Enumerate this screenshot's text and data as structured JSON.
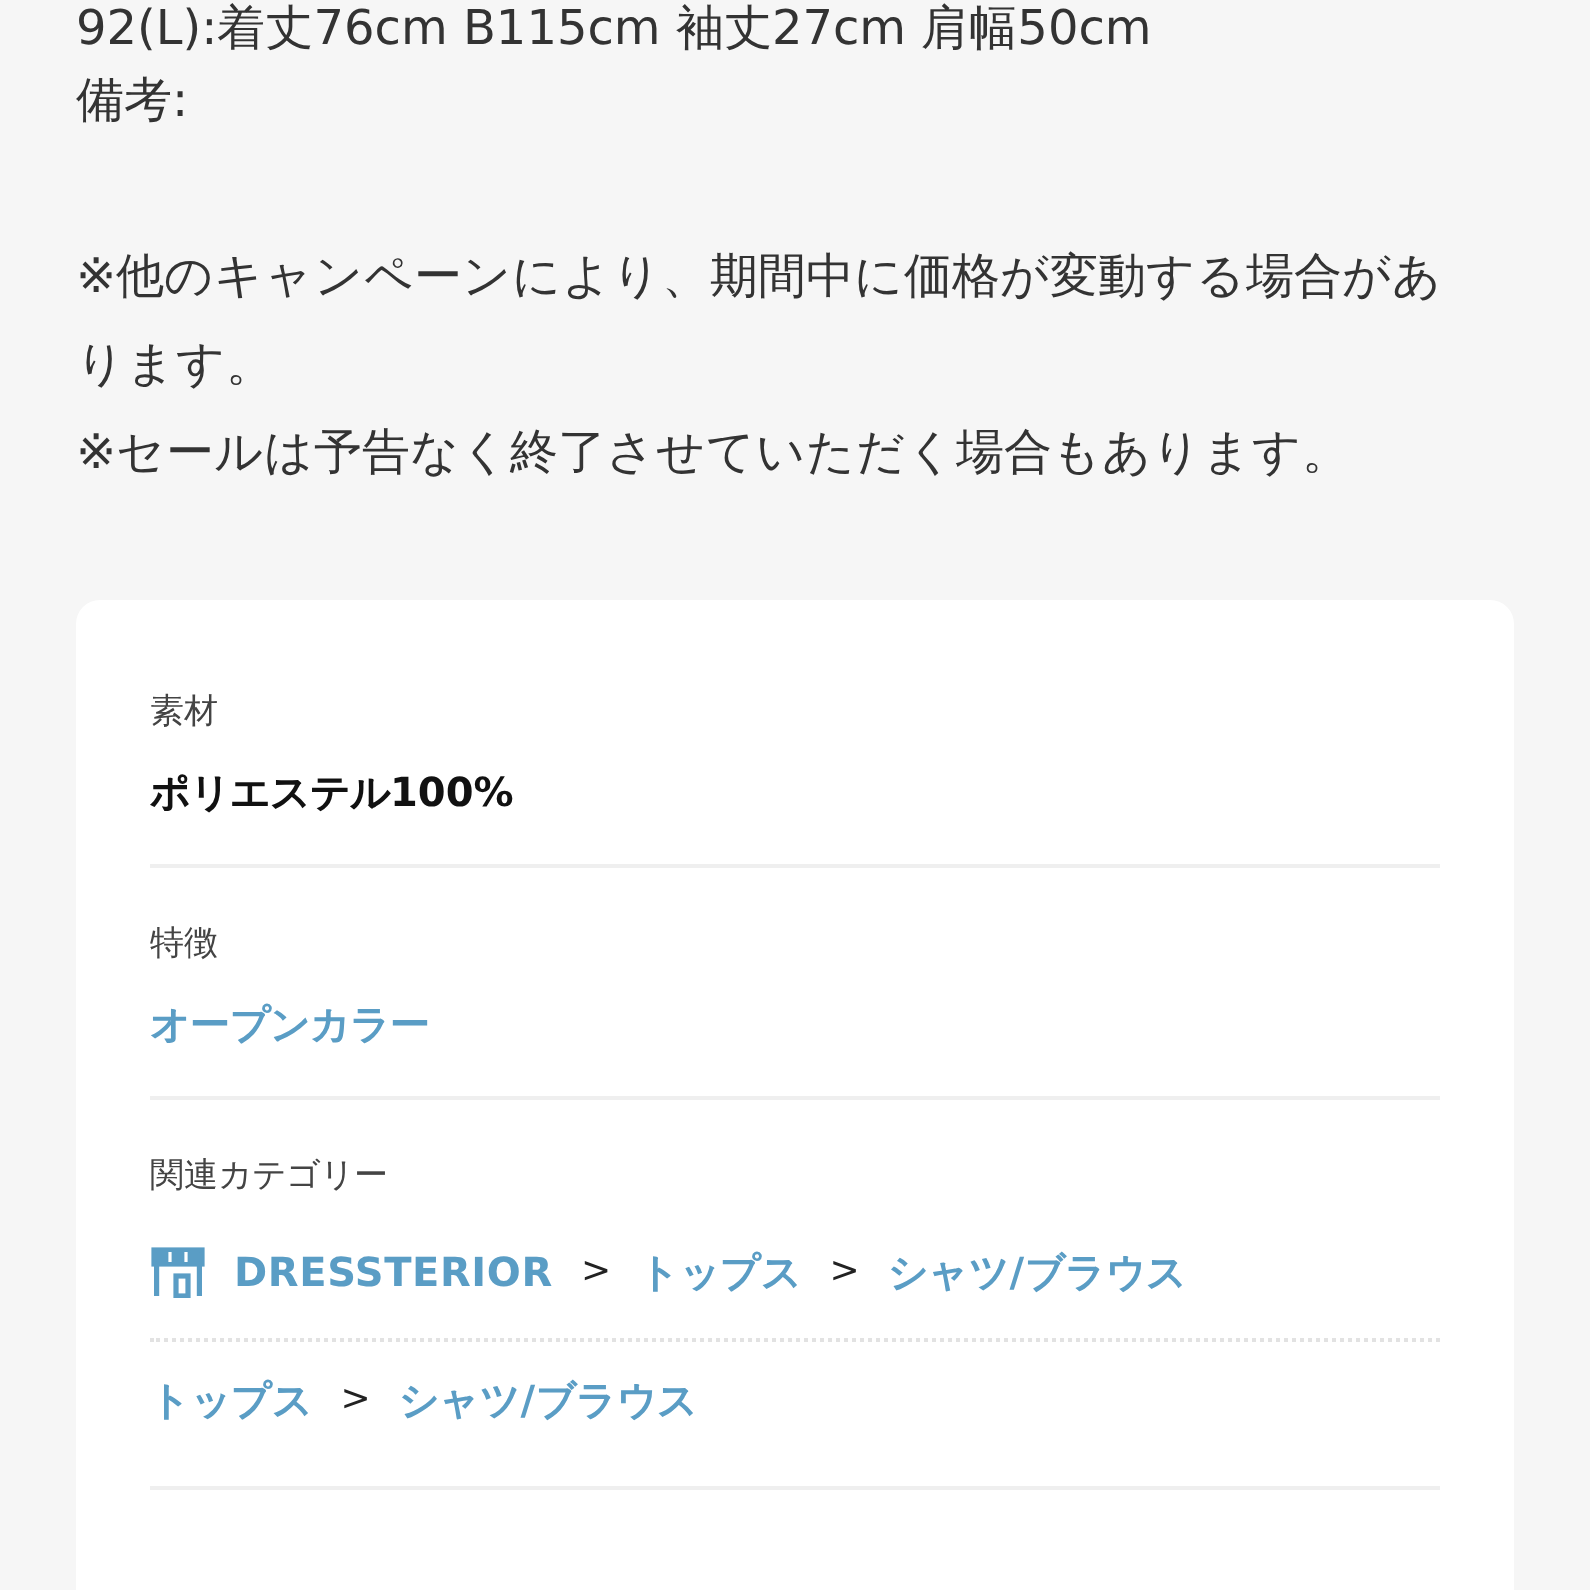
{
  "description": {
    "lines": [
      "92(L):着丈76cm B115cm 袖丈27cm 肩幅50cm",
      "備考:"
    ],
    "notes": [
      "※他のキャンペーンにより、期間中に価格が変動する場合があります。",
      "※セールは予告なく終了させていただく場合もあります。"
    ]
  },
  "details": {
    "sections": [
      {
        "kind": "text",
        "label": "素材",
        "value": "ポリエステル100%"
      },
      {
        "kind": "link",
        "label": "特徴",
        "value": "オープンカラー"
      },
      {
        "kind": "breadcrumbs",
        "label": "関連カテゴリー",
        "paths": [
          {
            "items": [
              {
                "kind": "shop",
                "label": "DRESSTERIOR"
              },
              {
                "kind": "separator",
                "label": ">"
              },
              {
                "kind": "category",
                "label": "トップス"
              },
              {
                "kind": "separator",
                "label": ">"
              },
              {
                "kind": "category",
                "label": "シャツ/ブラウス"
              }
            ]
          },
          {
            "items": [
              {
                "kind": "category",
                "label": "トップス"
              },
              {
                "kind": "separator",
                "label": ">"
              },
              {
                "kind": "category",
                "label": "シャツ/ブラウス"
              }
            ]
          }
        ]
      }
    ]
  }
}
